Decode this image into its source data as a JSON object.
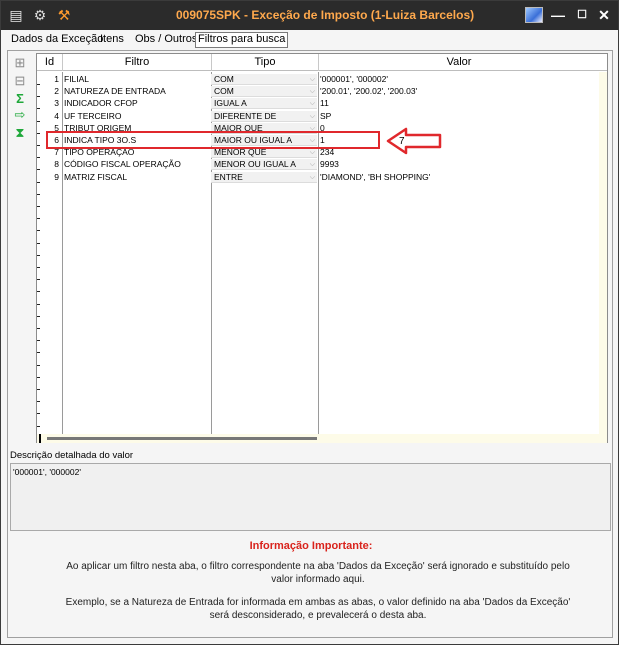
{
  "window": {
    "title": "009075SPK - Exceção de Imposto (1-Luiza Barcelos)",
    "controls": [
      "—",
      "☐",
      "✕"
    ]
  },
  "tabs": [
    {
      "label": "Dados da Exceção",
      "active": false
    },
    {
      "label": "Itens",
      "active": false
    },
    {
      "label": "Obs / Outros",
      "active": false
    },
    {
      "label": "Filtros para busca",
      "active": true
    }
  ],
  "grid": {
    "headers": {
      "id": "Id",
      "filtro": "Filtro",
      "tipo": "Tipo",
      "valor": "Valor"
    },
    "rows": [
      {
        "id": "1",
        "filtro": "FILIAL",
        "tipo": "COM",
        "valor": "'000001', '000002'"
      },
      {
        "id": "2",
        "filtro": "NATUREZA DE ENTRADA",
        "tipo": "COM",
        "valor": "'200.01', '200.02', '200.03'"
      },
      {
        "id": "3",
        "filtro": "INDICADOR CFOP",
        "tipo": "IGUAL A",
        "valor": "11"
      },
      {
        "id": "4",
        "filtro": "UF TERCEIRO",
        "tipo": "DIFERENTE DE",
        "valor": "SP"
      },
      {
        "id": "5",
        "filtro": "TRIBUT ORIGEM",
        "tipo": "MAIOR QUE",
        "valor": "0"
      },
      {
        "id": "6",
        "filtro": "INDICA TIPO 3O.S",
        "tipo": "MAIOR OU IGUAL A",
        "valor": "1"
      },
      {
        "id": "7",
        "filtro": "TIPO OPERAÇÃO",
        "tipo": "MENOR QUE",
        "valor": "234"
      },
      {
        "id": "8",
        "filtro": "CÓDIGO FISCAL OPERAÇÃO",
        "tipo": "MENOR OU IGUAL A",
        "valor": "9993"
      },
      {
        "id": "9",
        "filtro": "MATRIZ FISCAL",
        "tipo": "ENTRE",
        "valor": "'DIAMOND', 'BH SHOPPING'"
      }
    ]
  },
  "annotation": {
    "number": "7",
    "color": "#e0282c"
  },
  "description": {
    "label": "Descrição detalhada do valor",
    "value": "'000001', '000002'"
  },
  "info": {
    "title": "Informação Importante:",
    "paragraph1": "Ao aplicar um filtro nesta aba, o filtro correspondente na aba 'Dados da Exceção' será ignorado e substituído pelo valor informado aqui.",
    "paragraph2": "Exemplo, se a Natureza de Entrada for informada em ambas as abas, o valor definido na aba 'Dados da Exceção' será desconsiderado, e prevalecerá o desta aba."
  },
  "icons": {
    "window": "window-icon",
    "app": "app-logo-icon",
    "tool": "wrench-icon",
    "image": "image-icon",
    "add_row": "add-row-icon",
    "remove_row": "remove-row-icon",
    "sum": "sum-icon",
    "export": "export-icon",
    "filter": "filter-icon"
  },
  "colors": {
    "titlebar_bg": "#2b2b2b",
    "title_text": "#ffa94d",
    "accent_red": "#e0282c",
    "scroll_bg": "#fdfbe8"
  }
}
